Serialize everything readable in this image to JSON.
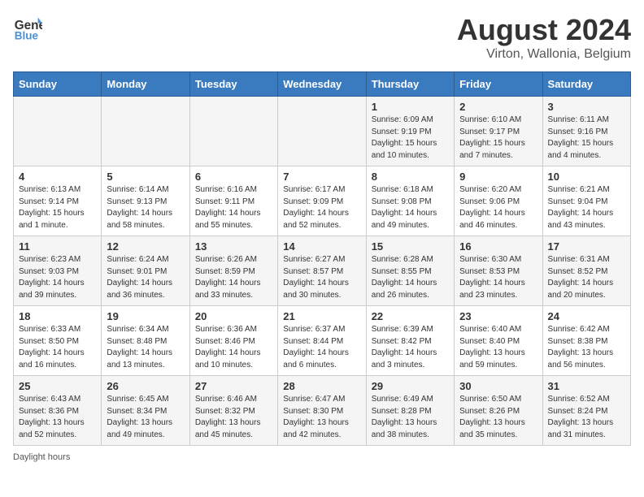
{
  "header": {
    "logo_line1": "General",
    "logo_line2": "Blue",
    "main_title": "August 2024",
    "sub_title": "Virton, Wallonia, Belgium"
  },
  "days_of_week": [
    "Sunday",
    "Monday",
    "Tuesday",
    "Wednesday",
    "Thursday",
    "Friday",
    "Saturday"
  ],
  "weeks": [
    [
      {
        "num": "",
        "text": ""
      },
      {
        "num": "",
        "text": ""
      },
      {
        "num": "",
        "text": ""
      },
      {
        "num": "",
        "text": ""
      },
      {
        "num": "1",
        "text": "Sunrise: 6:09 AM\nSunset: 9:19 PM\nDaylight: 15 hours and 10 minutes."
      },
      {
        "num": "2",
        "text": "Sunrise: 6:10 AM\nSunset: 9:17 PM\nDaylight: 15 hours and 7 minutes."
      },
      {
        "num": "3",
        "text": "Sunrise: 6:11 AM\nSunset: 9:16 PM\nDaylight: 15 hours and 4 minutes."
      }
    ],
    [
      {
        "num": "4",
        "text": "Sunrise: 6:13 AM\nSunset: 9:14 PM\nDaylight: 15 hours and 1 minute."
      },
      {
        "num": "5",
        "text": "Sunrise: 6:14 AM\nSunset: 9:13 PM\nDaylight: 14 hours and 58 minutes."
      },
      {
        "num": "6",
        "text": "Sunrise: 6:16 AM\nSunset: 9:11 PM\nDaylight: 14 hours and 55 minutes."
      },
      {
        "num": "7",
        "text": "Sunrise: 6:17 AM\nSunset: 9:09 PM\nDaylight: 14 hours and 52 minutes."
      },
      {
        "num": "8",
        "text": "Sunrise: 6:18 AM\nSunset: 9:08 PM\nDaylight: 14 hours and 49 minutes."
      },
      {
        "num": "9",
        "text": "Sunrise: 6:20 AM\nSunset: 9:06 PM\nDaylight: 14 hours and 46 minutes."
      },
      {
        "num": "10",
        "text": "Sunrise: 6:21 AM\nSunset: 9:04 PM\nDaylight: 14 hours and 43 minutes."
      }
    ],
    [
      {
        "num": "11",
        "text": "Sunrise: 6:23 AM\nSunset: 9:03 PM\nDaylight: 14 hours and 39 minutes."
      },
      {
        "num": "12",
        "text": "Sunrise: 6:24 AM\nSunset: 9:01 PM\nDaylight: 14 hours and 36 minutes."
      },
      {
        "num": "13",
        "text": "Sunrise: 6:26 AM\nSunset: 8:59 PM\nDaylight: 14 hours and 33 minutes."
      },
      {
        "num": "14",
        "text": "Sunrise: 6:27 AM\nSunset: 8:57 PM\nDaylight: 14 hours and 30 minutes."
      },
      {
        "num": "15",
        "text": "Sunrise: 6:28 AM\nSunset: 8:55 PM\nDaylight: 14 hours and 26 minutes."
      },
      {
        "num": "16",
        "text": "Sunrise: 6:30 AM\nSunset: 8:53 PM\nDaylight: 14 hours and 23 minutes."
      },
      {
        "num": "17",
        "text": "Sunrise: 6:31 AM\nSunset: 8:52 PM\nDaylight: 14 hours and 20 minutes."
      }
    ],
    [
      {
        "num": "18",
        "text": "Sunrise: 6:33 AM\nSunset: 8:50 PM\nDaylight: 14 hours and 16 minutes."
      },
      {
        "num": "19",
        "text": "Sunrise: 6:34 AM\nSunset: 8:48 PM\nDaylight: 14 hours and 13 minutes."
      },
      {
        "num": "20",
        "text": "Sunrise: 6:36 AM\nSunset: 8:46 PM\nDaylight: 14 hours and 10 minutes."
      },
      {
        "num": "21",
        "text": "Sunrise: 6:37 AM\nSunset: 8:44 PM\nDaylight: 14 hours and 6 minutes."
      },
      {
        "num": "22",
        "text": "Sunrise: 6:39 AM\nSunset: 8:42 PM\nDaylight: 14 hours and 3 minutes."
      },
      {
        "num": "23",
        "text": "Sunrise: 6:40 AM\nSunset: 8:40 PM\nDaylight: 13 hours and 59 minutes."
      },
      {
        "num": "24",
        "text": "Sunrise: 6:42 AM\nSunset: 8:38 PM\nDaylight: 13 hours and 56 minutes."
      }
    ],
    [
      {
        "num": "25",
        "text": "Sunrise: 6:43 AM\nSunset: 8:36 PM\nDaylight: 13 hours and 52 minutes."
      },
      {
        "num": "26",
        "text": "Sunrise: 6:45 AM\nSunset: 8:34 PM\nDaylight: 13 hours and 49 minutes."
      },
      {
        "num": "27",
        "text": "Sunrise: 6:46 AM\nSunset: 8:32 PM\nDaylight: 13 hours and 45 minutes."
      },
      {
        "num": "28",
        "text": "Sunrise: 6:47 AM\nSunset: 8:30 PM\nDaylight: 13 hours and 42 minutes."
      },
      {
        "num": "29",
        "text": "Sunrise: 6:49 AM\nSunset: 8:28 PM\nDaylight: 13 hours and 38 minutes."
      },
      {
        "num": "30",
        "text": "Sunrise: 6:50 AM\nSunset: 8:26 PM\nDaylight: 13 hours and 35 minutes."
      },
      {
        "num": "31",
        "text": "Sunrise: 6:52 AM\nSunset: 8:24 PM\nDaylight: 13 hours and 31 minutes."
      }
    ]
  ],
  "footer": {
    "label": "Daylight hours"
  }
}
